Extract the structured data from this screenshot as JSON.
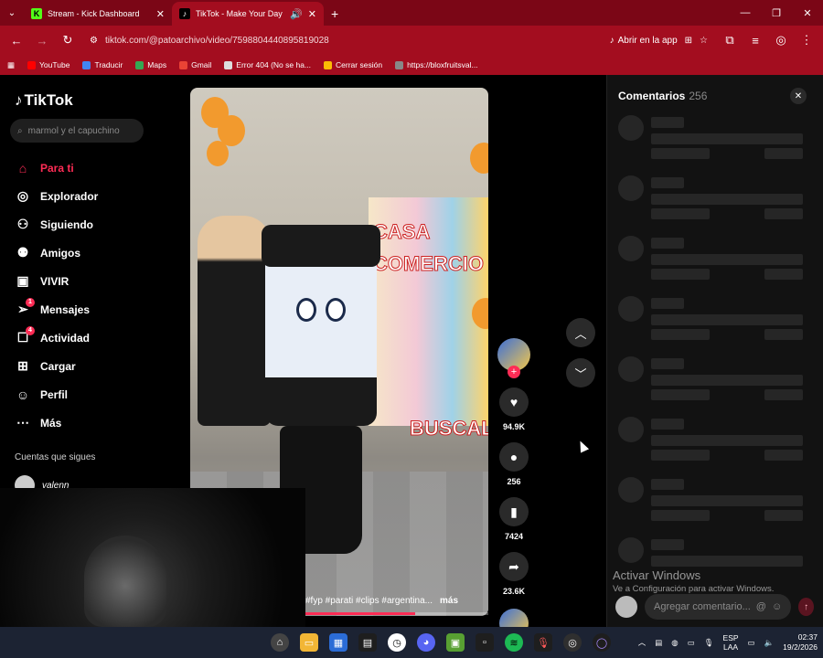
{
  "browser": {
    "tabs": [
      {
        "title": "Stream - Kick Dashboard",
        "icon": "kick-icon",
        "active": false
      },
      {
        "title": "TikTok - Make Your Day",
        "icon": "tiktok-icon",
        "active": true
      }
    ],
    "url": "tiktok.com/@patoarchivo/video/7598804440895819028",
    "open_in_app": "Abrir en la app",
    "bookmarks": [
      "YouTube",
      "Traducir",
      "Maps",
      "Gmail",
      "Error 404 (No se ha...",
      "Cerrar sesión",
      "https://bloxfruitsval..."
    ]
  },
  "sidebar": {
    "logo": "TikTok",
    "search_placeholder": "marmol y el capuchino",
    "nav": [
      {
        "label": "Para ti",
        "icon": "home-icon",
        "active": true,
        "badge": ""
      },
      {
        "label": "Explorador",
        "icon": "compass-icon",
        "active": false,
        "badge": ""
      },
      {
        "label": "Siguiendo",
        "icon": "following-icon",
        "active": false,
        "badge": ""
      },
      {
        "label": "Amigos",
        "icon": "friends-icon",
        "active": false,
        "badge": ""
      },
      {
        "label": "VIVIR",
        "icon": "live-icon",
        "active": false,
        "badge": ""
      },
      {
        "label": "Mensajes",
        "icon": "messages-icon",
        "active": false,
        "badge": "1"
      },
      {
        "label": "Actividad",
        "icon": "activity-icon",
        "active": false,
        "badge": "4"
      },
      {
        "label": "Cargar",
        "icon": "upload-icon",
        "active": false,
        "badge": ""
      },
      {
        "label": "Perfil",
        "icon": "profile-icon",
        "active": false,
        "badge": ""
      },
      {
        "label": "Más",
        "icon": "more-icon",
        "active": false,
        "badge": ""
      }
    ],
    "follows_title": "Cuentas que sigues",
    "followed_user": "valenn"
  },
  "video": {
    "store_sign": "CASA COMERCIO",
    "store_sign2": "BUSCAL",
    "caption": "#fyp #parati #clips #argentina...",
    "more": "más",
    "progress": 0.6
  },
  "actions": {
    "likes": "94.9K",
    "comments": "256",
    "saves": "7424",
    "shares": "23.6K"
  },
  "comments_panel": {
    "title": "Comentarios",
    "count": "256",
    "input_placeholder": "Agregar comentario..."
  },
  "watermark": {
    "line1": "Activar Windows",
    "line2": "Ve a Configuración para activar Windows."
  },
  "tray": {
    "lang1": "ESP",
    "lang2": "LAA",
    "time": "02:37",
    "date": "19/2/2026"
  },
  "colors": {
    "accent": "#fe2c55",
    "browser": "#a30d1f",
    "tabbar": "#7b0616"
  }
}
